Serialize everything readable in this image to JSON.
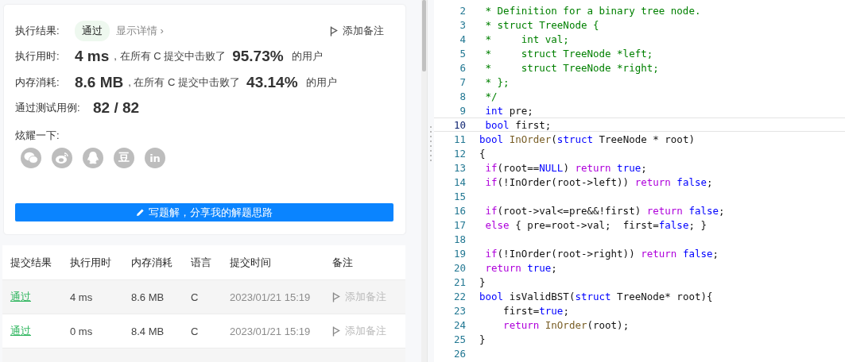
{
  "result_card": {
    "result_label": "执行结果:",
    "result_badge": "通过",
    "details_link": "显示详情 ›",
    "add_note": "添加备注",
    "stats": [
      {
        "label": "执行用时:",
        "value": "4 ms",
        "beat_text": ", 在所有 C 提交中击败了",
        "percent": "95.73%",
        "suffix": "的用户"
      },
      {
        "label": "内存消耗:",
        "value": "8.6 MB",
        "beat_text": ", 在所有 C 提交中击败了",
        "percent": "43.14%",
        "suffix": "的用户"
      }
    ],
    "tests": {
      "label": "通过测试用例:",
      "value": "82 / 82"
    },
    "share_label": "炫耀一下:",
    "share_icons": [
      {
        "kind": "wechat"
      },
      {
        "kind": "weibo"
      },
      {
        "kind": "qq"
      },
      {
        "kind": "douban",
        "glyph": "豆"
      },
      {
        "kind": "linkedin",
        "glyph": "in"
      }
    ],
    "write_button": "写题解，分享我的解题思路"
  },
  "submissions": {
    "columns": [
      "提交结果",
      "执行用时",
      "内存消耗",
      "语言",
      "提交时间",
      "备注"
    ],
    "rows": [
      {
        "status": "通过",
        "runtime": "4 ms",
        "memory": "8.6 MB",
        "language": "C",
        "time": "2023/01/21 15:19",
        "note": "添加备注"
      },
      {
        "status": "通过",
        "runtime": "0 ms",
        "memory": "8.4 MB",
        "language": "C",
        "time": "2023/01/21 15:19",
        "note": "添加备注"
      }
    ]
  },
  "editor": {
    "lines": [
      {
        "number": "2",
        "current": false,
        "tokens": [
          {
            "kind": "comment",
            "text": " * Definition for a binary tree node."
          }
        ]
      },
      {
        "number": "3",
        "current": false,
        "tokens": [
          {
            "kind": "comment",
            "text": " * struct TreeNode {"
          }
        ]
      },
      {
        "number": "4",
        "current": false,
        "tokens": [
          {
            "kind": "comment",
            "text": " *     int val;"
          }
        ]
      },
      {
        "number": "5",
        "current": false,
        "tokens": [
          {
            "kind": "comment",
            "text": " *     struct TreeNode *left;"
          }
        ]
      },
      {
        "number": "6",
        "current": false,
        "tokens": [
          {
            "kind": "comment",
            "text": " *     struct TreeNode *right;"
          }
        ]
      },
      {
        "number": "7",
        "current": false,
        "tokens": [
          {
            "kind": "comment",
            "text": " * };"
          }
        ]
      },
      {
        "number": "8",
        "current": false,
        "tokens": [
          {
            "kind": "comment",
            "text": " */"
          }
        ]
      },
      {
        "number": "9",
        "current": false,
        "tokens": [
          {
            "kind": "type",
            "text": " int"
          },
          {
            "kind": "plain",
            "text": " pre;"
          }
        ]
      },
      {
        "number": "10",
        "current": true,
        "tokens": [
          {
            "kind": "type",
            "text": " bool"
          },
          {
            "kind": "plain",
            "text": " first;"
          }
        ]
      },
      {
        "number": "11",
        "current": false,
        "tokens": [
          {
            "kind": "type",
            "text": "bool"
          },
          {
            "kind": "func",
            "text": " InOrder"
          },
          {
            "kind": "plain",
            "text": "("
          },
          {
            "kind": "type",
            "text": "struct"
          },
          {
            "kind": "plain",
            "text": " TreeNode * root)"
          }
        ]
      },
      {
        "number": "12",
        "current": false,
        "tokens": [
          {
            "kind": "plain",
            "text": "{"
          }
        ]
      },
      {
        "number": "13",
        "current": false,
        "tokens": [
          {
            "kind": "keyword",
            "text": " if"
          },
          {
            "kind": "plain",
            "text": "(root=="
          },
          {
            "kind": "type",
            "text": "NULL"
          },
          {
            "kind": "plain",
            "text": ") "
          },
          {
            "kind": "keyword",
            "text": "return"
          },
          {
            "kind": "type",
            "text": " true"
          },
          {
            "kind": "plain",
            "text": ";"
          }
        ]
      },
      {
        "number": "14",
        "current": false,
        "tokens": [
          {
            "kind": "keyword",
            "text": " if"
          },
          {
            "kind": "plain",
            "text": "(!InOrder(root->left)) "
          },
          {
            "kind": "keyword",
            "text": "return"
          },
          {
            "kind": "type",
            "text": " false"
          },
          {
            "kind": "plain",
            "text": ";"
          }
        ]
      },
      {
        "number": "15",
        "current": false
      },
      {
        "number": "16",
        "current": false,
        "tokens": [
          {
            "kind": "keyword",
            "text": " if"
          },
          {
            "kind": "plain",
            "text": "(root->val<=pre&&!first) "
          },
          {
            "kind": "keyword",
            "text": "return"
          },
          {
            "kind": "type",
            "text": " false"
          },
          {
            "kind": "plain",
            "text": ";"
          }
        ]
      },
      {
        "number": "17",
        "current": false,
        "tokens": [
          {
            "kind": "keyword",
            "text": " else"
          },
          {
            "kind": "plain",
            "text": " { pre=root->val;  first="
          },
          {
            "kind": "type",
            "text": "false"
          },
          {
            "kind": "plain",
            "text": "; }"
          }
        ]
      },
      {
        "number": "18",
        "current": false
      },
      {
        "number": "19",
        "current": false,
        "tokens": [
          {
            "kind": "keyword",
            "text": " if"
          },
          {
            "kind": "plain",
            "text": "(!InOrder(root->right)) "
          },
          {
            "kind": "keyword",
            "text": "return"
          },
          {
            "kind": "type",
            "text": " false"
          },
          {
            "kind": "plain",
            "text": ";"
          }
        ]
      },
      {
        "number": "20",
        "current": false,
        "tokens": [
          {
            "kind": "keyword",
            "text": " return"
          },
          {
            "kind": "type",
            "text": " true"
          },
          {
            "kind": "plain",
            "text": ";"
          }
        ]
      },
      {
        "number": "21",
        "current": false,
        "tokens": [
          {
            "kind": "plain",
            "text": "}"
          }
        ]
      },
      {
        "number": "22",
        "current": false,
        "tokens": [
          {
            "kind": "type",
            "text": "bool"
          },
          {
            "kind": "plain",
            "text": " isValidBST("
          },
          {
            "kind": "type",
            "text": "struct"
          },
          {
            "kind": "plain",
            "text": " TreeNode* root){"
          }
        ]
      },
      {
        "number": "23",
        "current": false,
        "tokens": [
          {
            "kind": "plain",
            "text": "    first="
          },
          {
            "kind": "type",
            "text": "true"
          },
          {
            "kind": "plain",
            "text": ";"
          }
        ]
      },
      {
        "number": "24",
        "current": false,
        "tokens": [
          {
            "kind": "keyword",
            "text": "    return"
          },
          {
            "kind": "func",
            "text": " InOrder"
          },
          {
            "kind": "plain",
            "text": "(root);"
          }
        ]
      },
      {
        "number": "25",
        "current": false,
        "tokens": [
          {
            "kind": "plain",
            "text": "}"
          }
        ]
      },
      {
        "number": "26",
        "current": false
      }
    ]
  }
}
